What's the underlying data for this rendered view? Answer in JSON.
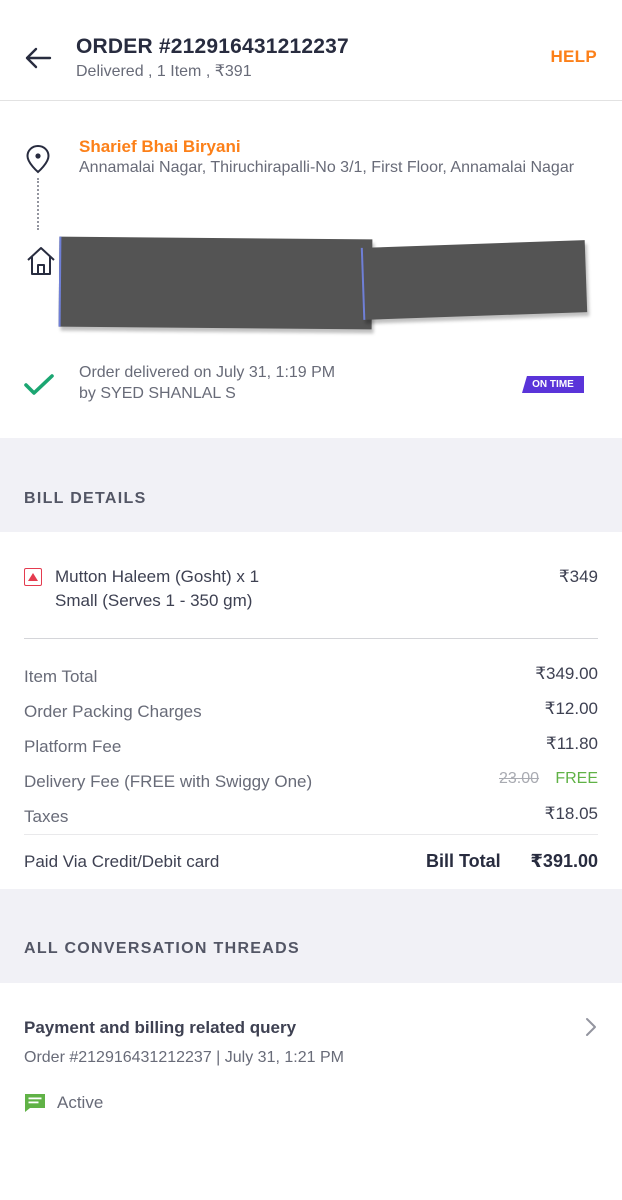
{
  "header": {
    "order_title": "ORDER #212916431212237",
    "order_subtitle": "Delivered , 1 Item , ₹391",
    "help_label": "HELP",
    "back_icon": "arrow-left-icon"
  },
  "route": {
    "restaurant_name": "Sharief Bhai Biryani",
    "restaurant_address": "Annamalai Nagar, Thiruchirapalli-No 3/1, First Floor, Annamalai Nagar",
    "pickup_icon": "location-pin-icon",
    "drop_icon": "home-icon",
    "delivered_text": "Order delivered on July 31, 1:19 PM",
    "delivered_by": "by SYED SHANLAL S",
    "badge": "ON TIME",
    "status_icon": "checkmark-icon",
    "colors": {
      "accent": "#fc8019",
      "success": "#1ba672",
      "badge": "#5a34d9"
    }
  },
  "bill": {
    "section_title": "BILL DETAILS",
    "item": {
      "name": "Mutton Haleem (Gosht) x 1",
      "variant": "Small (Serves 1 - 350 gm)",
      "price": "₹349",
      "type_icon": "non-veg-icon"
    },
    "rows": [
      {
        "label": "Item Total",
        "value": "₹349.00"
      },
      {
        "label": "Order Packing Charges",
        "value": "₹12.00"
      },
      {
        "label": "Platform Fee",
        "value": "₹11.80"
      },
      {
        "label": "Delivery Fee (FREE with Swiggy One)",
        "original": "23.00",
        "value": "FREE"
      },
      {
        "label": "Taxes",
        "value": "₹18.05"
      }
    ],
    "paid_via": "Paid Via Credit/Debit card",
    "total_label": "Bill Total",
    "total_value": "₹391.00"
  },
  "conversations": {
    "section_title": "ALL CONVERSATION THREADS",
    "thread": {
      "title": "Payment and billing related query",
      "subtitle": "Order #212916431212237 | July 31, 1:21 PM",
      "status": "Active",
      "status_icon": "chat-message-icon",
      "chevron_icon": "chevron-right-icon"
    }
  }
}
